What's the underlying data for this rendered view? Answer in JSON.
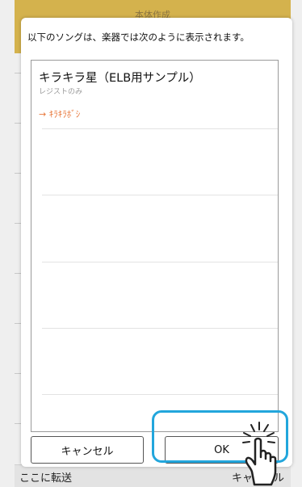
{
  "background": {
    "top_title": "本体作成",
    "bottom_left": "ここに転送",
    "bottom_right": "キャンセル"
  },
  "dialog": {
    "message": "以下のソングは、楽器では次のように表示されます。",
    "song": {
      "title": "キラキラ星（ELB用サンプル）",
      "subtitle": "レジストのみ",
      "converted": "→ ｷﾗｷﾗﾎﾞｼ"
    },
    "cancel_label": "キャンセル",
    "ok_label": "OK"
  },
  "colors": {
    "header_bar": "#d4b24d",
    "converted_text": "#e8773a",
    "highlight": "#22a6dc"
  },
  "icons": {
    "tap_indicator": "hand-tap-icon"
  }
}
